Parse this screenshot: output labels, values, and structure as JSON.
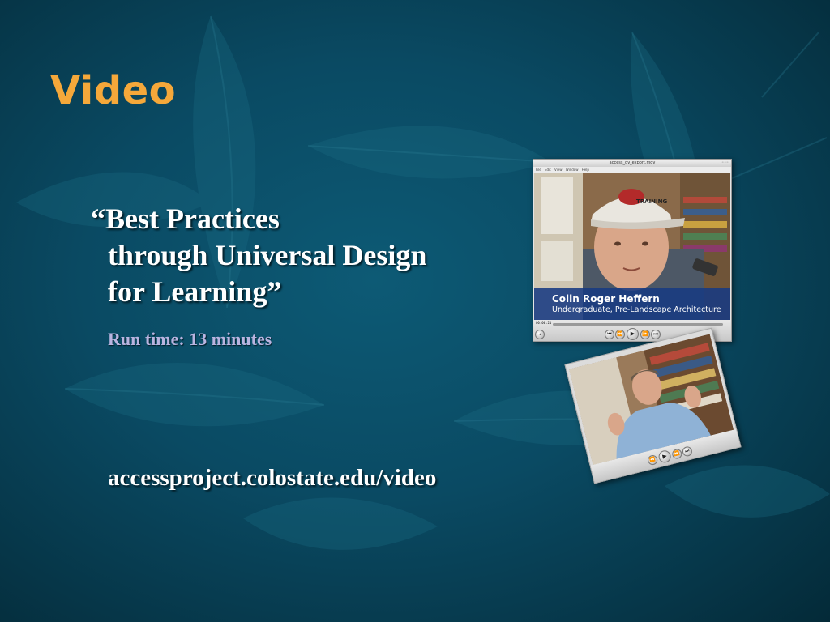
{
  "slide": {
    "title": "Video",
    "quote_line1": "“Best Practices",
    "quote_line2": "through Universal Design",
    "quote_line3": "for Learning”",
    "runtime": "Run time: 13 minutes",
    "url": "accessproject.colostate.edu/video"
  },
  "player1": {
    "window_title": "access_dv_export.mov",
    "menu": "File Edit View Window Help",
    "caption_name": "Colin Roger Heffern",
    "caption_role": "Undergraduate, Pre-Landscape Architecture",
    "cap_text": "TRAINING",
    "timecode": "00:00:21"
  },
  "colors": {
    "background": "#0a4a63",
    "title": "#f5a83a",
    "runtime": "#b9b4e0",
    "caption_band": "#183a82"
  }
}
